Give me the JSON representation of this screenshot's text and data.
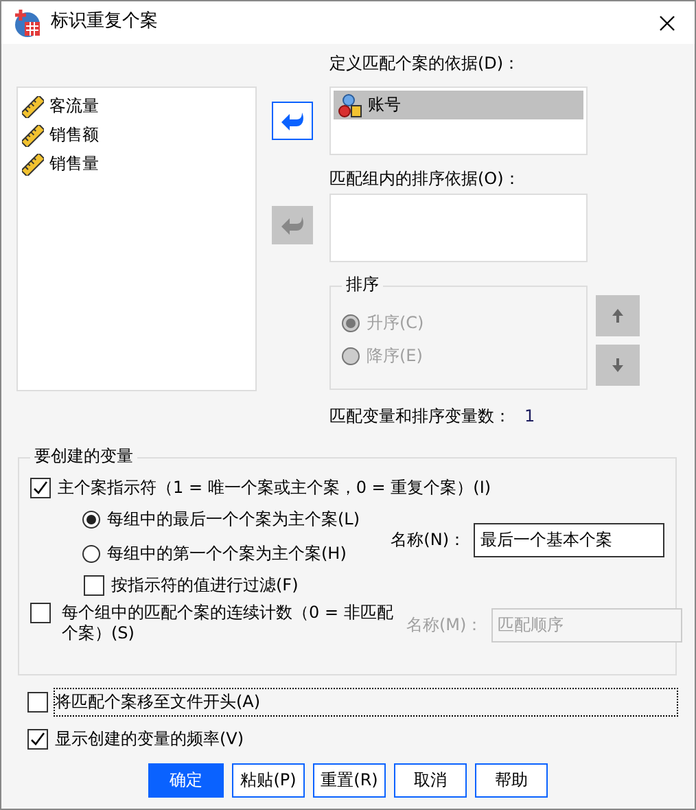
{
  "window": {
    "title": "标识重复个案"
  },
  "source_variables": [
    {
      "name": "客流量",
      "kind": "scale",
      "selected": false
    },
    {
      "name": "销售额",
      "kind": "scale",
      "selected": false
    },
    {
      "name": "销售量",
      "kind": "scale",
      "selected": false
    }
  ],
  "move_match_button": {
    "disabled": false
  },
  "move_sort_button": {
    "disabled": true
  },
  "match_label": "定义匹配个案的依据(D)：",
  "match_variables": [
    {
      "name": "账号",
      "kind": "nominal",
      "selected": true
    }
  ],
  "sort_label": "匹配组内的排序依据(O)：",
  "sort_order": {
    "title": "排序",
    "options": [
      {
        "label": "升序(C)",
        "selected": true,
        "disabled": true
      },
      {
        "label": "降序(E)",
        "selected": false,
        "disabled": true
      }
    ],
    "move_up": {
      "disabled": true
    },
    "move_down": {
      "disabled": true
    }
  },
  "count": {
    "label": "匹配变量和排序变量数：",
    "value": "1"
  },
  "create_group": {
    "title": "要创建的变量",
    "primary_indicator": {
      "label": "主个案指示符（1 = 唯一个案或主个案，0 = 重复个案）(I)",
      "checked": true
    },
    "primary_options": [
      {
        "label": "每组中的最后一个个案为主个案(L)",
        "selected": true
      },
      {
        "label": "每组中的第一个个案为主个案(H)",
        "selected": false
      }
    ],
    "name_label": "名称(N)：",
    "name_value": "最后一个基本个案",
    "filter": {
      "label": "按指示符的值进行过滤(F)",
      "checked": false
    },
    "sequential": {
      "label": "每个组中的匹配个案的连续计数（0 = 非匹配个案）(S)",
      "checked": false
    },
    "sequential_name_label": "名称(M)：",
    "sequential_name_value": "匹配顺序",
    "sequential_name_disabled": true
  },
  "move_to_top": {
    "label": "将匹配个案移至文件开头(A)",
    "checked": false,
    "focused": true
  },
  "show_frequencies": {
    "label": "显示创建的变量的频率(V)",
    "checked": true
  },
  "buttons": [
    {
      "label": "确定",
      "default": true
    },
    {
      "label": "粘贴(P)",
      "default": false
    },
    {
      "label": "重置(R)",
      "default": false
    },
    {
      "label": "取消",
      "default": false
    },
    {
      "label": "帮助",
      "default": false
    }
  ]
}
